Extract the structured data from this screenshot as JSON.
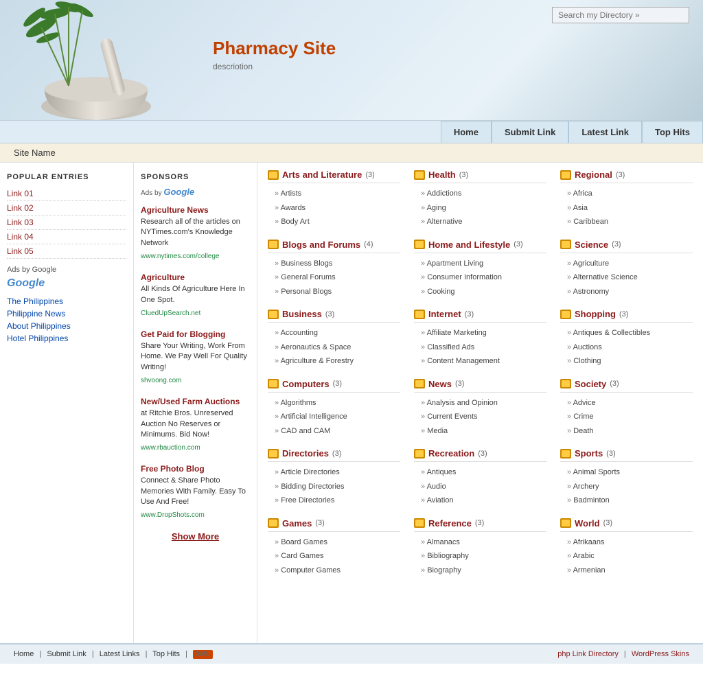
{
  "header": {
    "search_placeholder": "Search my Directory »",
    "site_title": "Pharmacy Site",
    "site_desc": "descriotion"
  },
  "navbar": {
    "home": "Home",
    "submit_link": "Submit Link",
    "latest_link": "Latest Link",
    "top_hits": "Top Hits"
  },
  "site_name_bar": {
    "label": "Site Name"
  },
  "sidebar": {
    "popular_title": "POPULAR ENTRIES",
    "links": [
      {
        "label": "Link 01"
      },
      {
        "label": "Link 02"
      },
      {
        "label": "Link 03"
      },
      {
        "label": "Link 04"
      },
      {
        "label": "Link 05"
      }
    ],
    "ads_label": "Ads by Google",
    "geo_links": [
      {
        "label": "The Philippines"
      },
      {
        "label": "Philippine News"
      },
      {
        "label": "About Philippines"
      },
      {
        "label": "Hotel Philippines"
      }
    ]
  },
  "sponsors": {
    "title": "SPONSORS",
    "ads_google": "Ads by Google",
    "items": [
      {
        "title": "Agriculture News",
        "desc": "Research all of the articles on NYTimes.com's Knowledge Network",
        "url": "www.nytimes.com/college"
      },
      {
        "title": "Agriculture",
        "desc": "All Kinds Of Agriculture Here In One Spot.",
        "url": "CluedUpSearch.net"
      },
      {
        "title": "Get Paid for Blogging",
        "desc": "Share Your Writing, Work From Home. We Pay Well For Quality Writing!",
        "url": "shvoong.com"
      },
      {
        "title": "New/Used Farm Auctions",
        "desc": "at Ritchie Bros. Unreserved Auction No Reserves or Minimums. Bid Now!",
        "url": "www.rbauction.com"
      },
      {
        "title": "Free Photo Blog",
        "desc": "Connect & Share Photo Memories With Family. Easy To Use And Free!",
        "url": "www.DropShots.com"
      }
    ],
    "show_more": "Show More"
  },
  "categories": [
    {
      "title": "Arts and Literature",
      "count": "(3)",
      "subs": [
        "Artists",
        "Awards",
        "Body Art"
      ]
    },
    {
      "title": "Health",
      "count": "(3)",
      "subs": [
        "Addictions",
        "Aging",
        "Alternative"
      ]
    },
    {
      "title": "Regional",
      "count": "(3)",
      "subs": [
        "Africa",
        "Asia",
        "Caribbean"
      ]
    },
    {
      "title": "Blogs and Forums",
      "count": "(4)",
      "subs": [
        "Business Blogs",
        "General Forums",
        "Personal Blogs"
      ]
    },
    {
      "title": "Home and Lifestyle",
      "count": "(3)",
      "subs": [
        "Apartment Living",
        "Consumer Information",
        "Cooking"
      ]
    },
    {
      "title": "Science",
      "count": "(3)",
      "subs": [
        "Agriculture",
        "Alternative Science",
        "Astronomy"
      ]
    },
    {
      "title": "Business",
      "count": "(3)",
      "subs": [
        "Accounting",
        "Aeronautics & Space",
        "Agriculture & Forestry"
      ]
    },
    {
      "title": "Internet",
      "count": "(3)",
      "subs": [
        "Affiliate Marketing",
        "Classified Ads",
        "Content Management"
      ]
    },
    {
      "title": "Shopping",
      "count": "(3)",
      "subs": [
        "Antiques & Collectibles",
        "Auctions",
        "Clothing"
      ]
    },
    {
      "title": "Computers",
      "count": "(3)",
      "subs": [
        "Algorithms",
        "Artificial Intelligence",
        "CAD and CAM"
      ]
    },
    {
      "title": "News",
      "count": "(3)",
      "subs": [
        "Analysis and Opinion",
        "Current Events",
        "Media"
      ]
    },
    {
      "title": "Society",
      "count": "(3)",
      "subs": [
        "Advice",
        "Crime",
        "Death"
      ]
    },
    {
      "title": "Directories",
      "count": "(3)",
      "subs": [
        "Article Directories",
        "Bidding Directories",
        "Free Directories"
      ]
    },
    {
      "title": "Recreation",
      "count": "(3)",
      "subs": [
        "Antiques",
        "Audio",
        "Aviation"
      ]
    },
    {
      "title": "Sports",
      "count": "(3)",
      "subs": [
        "Animal Sports",
        "Archery",
        "Badminton"
      ]
    },
    {
      "title": "Games",
      "count": "(3)",
      "subs": [
        "Board Games",
        "Card Games",
        "Computer Games"
      ]
    },
    {
      "title": "Reference",
      "count": "(3)",
      "subs": [
        "Almanacs",
        "Bibliography",
        "Biography"
      ]
    },
    {
      "title": "World",
      "count": "(3)",
      "subs": [
        "Afrikaans",
        "Arabic",
        "Armenian"
      ]
    }
  ],
  "footer": {
    "links": [
      "Home",
      "Submit Link",
      "Latest Links",
      "Top Hits"
    ],
    "xml_label": "XML",
    "right_links": [
      "php Link Directory",
      "WordPress Skins"
    ]
  }
}
